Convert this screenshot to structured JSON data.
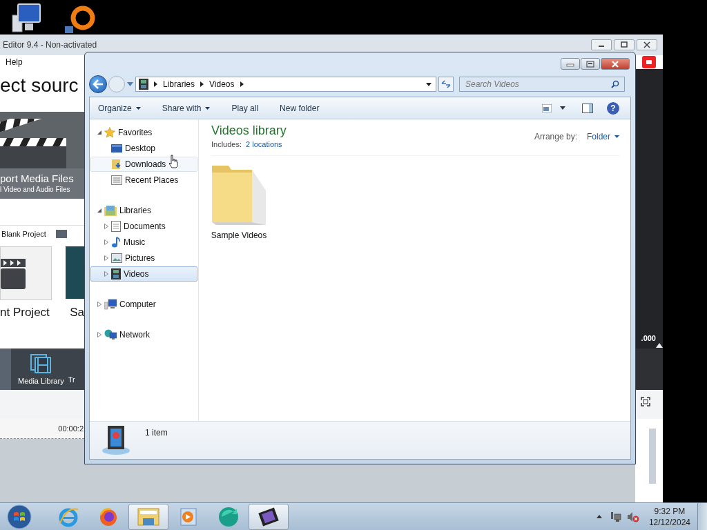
{
  "back_window": {
    "title": "Editor 9.4 - Non-activated",
    "menu": [
      "Help"
    ],
    "heading": "ect sourc",
    "import_title": "port Media Files",
    "import_subtitle": "l Video and Audio Files",
    "blank_project": "Blank Project",
    "recent_labels": [
      "nt Project",
      "Sa"
    ],
    "bottom_tabs": [
      "Media Library",
      "Tr"
    ],
    "timecode": "00:00:2",
    "readout": ".000"
  },
  "explorer": {
    "breadcrumb": [
      "Libraries",
      "Videos"
    ],
    "search": {
      "placeholder": "Search Videos"
    },
    "toolbar": [
      {
        "label": "Organize",
        "dropdown": true
      },
      {
        "label": "Share with",
        "dropdown": true
      },
      {
        "label": "Play all",
        "dropdown": false
      },
      {
        "label": "New folder",
        "dropdown": false
      }
    ],
    "nav": [
      {
        "label": "Favorites",
        "kind": "star",
        "expanded": true,
        "selected": false,
        "hovered": false,
        "children": [
          {
            "label": "Desktop",
            "kind": "desktop",
            "selected": false,
            "hovered": false
          },
          {
            "label": "Downloads",
            "kind": "downloads",
            "selected": false,
            "hovered": true
          },
          {
            "label": "Recent Places",
            "kind": "recent",
            "selected": false,
            "hovered": false
          }
        ]
      },
      {
        "label": "Libraries",
        "kind": "library",
        "expanded": true,
        "selected": false,
        "hovered": false,
        "children": [
          {
            "label": "Documents",
            "kind": "documents",
            "expanded": false,
            "selected": false,
            "hovered": false
          },
          {
            "label": "Music",
            "kind": "music",
            "expanded": false,
            "selected": false,
            "hovered": false
          },
          {
            "label": "Pictures",
            "kind": "pictures",
            "expanded": false,
            "selected": false,
            "hovered": false
          },
          {
            "label": "Videos",
            "kind": "videos",
            "expanded": false,
            "selected": true,
            "hovered": false
          }
        ]
      },
      {
        "label": "Computer",
        "kind": "computer",
        "expanded": false,
        "selected": false,
        "hovered": false
      },
      {
        "label": "Network",
        "kind": "network",
        "expanded": false,
        "selected": false,
        "hovered": false
      }
    ],
    "library_title": "Videos library",
    "includes_label": "Includes:",
    "locations_link": "2 locations",
    "arrange_label": "Arrange by:",
    "arrange_value": "Folder",
    "help_glyph": "?",
    "items": [
      {
        "name": "Sample Videos"
      }
    ],
    "status": "1 item"
  },
  "taskbar": {
    "apps": [
      {
        "kind": "ie",
        "active": false
      },
      {
        "kind": "firefox",
        "active": false
      },
      {
        "kind": "explorer",
        "active": true
      },
      {
        "kind": "player",
        "active": false
      },
      {
        "kind": "green",
        "active": false
      },
      {
        "kind": "film",
        "active": true
      }
    ],
    "time": "9:32 PM",
    "date": "12/12/2024"
  }
}
